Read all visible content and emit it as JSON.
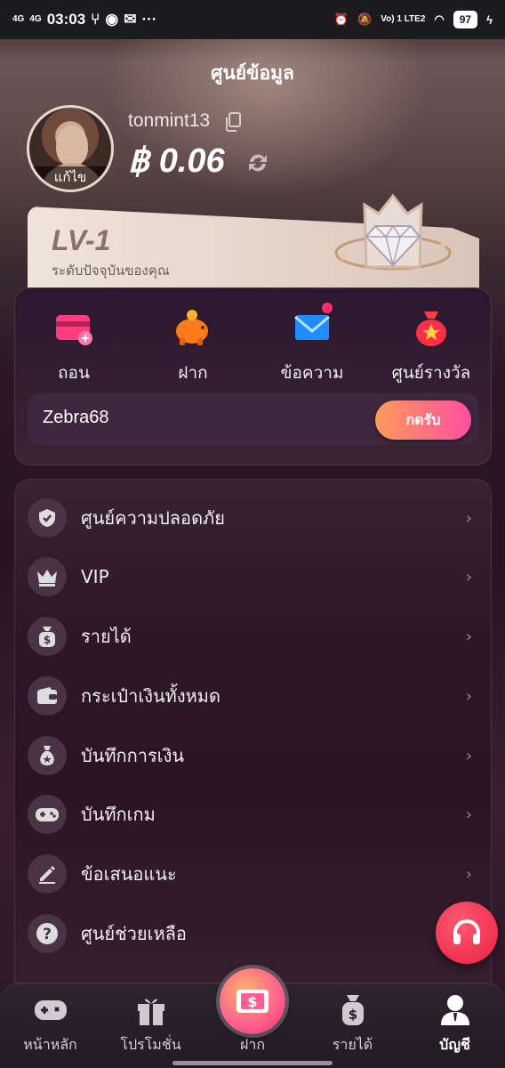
{
  "status_bar": {
    "signal_1": "4G",
    "signal_2": "4G",
    "time": "03:03",
    "network": "Vo) 1 LTE2",
    "battery": "97"
  },
  "header": {
    "title": "ศูนย์ข้อมูล",
    "avatar_edit": "แก้ไข",
    "username": "tonmint13",
    "balance": "฿ 0.06"
  },
  "level": {
    "name": "LV-1",
    "subtitle": "ระดับปัจจุบันของคุณ"
  },
  "quick_actions": [
    {
      "label": "ถอน",
      "icon": "withdraw-card-icon"
    },
    {
      "label": "ฝาก",
      "icon": "piggy-bank-icon"
    },
    {
      "label": "ข้อความ",
      "icon": "mail-icon"
    },
    {
      "label": "ศูนย์รางวัล",
      "icon": "reward-bag-icon"
    }
  ],
  "promo": {
    "name": "Zebra68",
    "claim_label": "กดรับ"
  },
  "menu": [
    {
      "label": "ศูนย์ความปลอดภัย",
      "icon": "shield-check-icon"
    },
    {
      "label": "VIP",
      "icon": "crown-icon"
    },
    {
      "label": "รายได้",
      "icon": "money-bag-icon"
    },
    {
      "label": "กระเป๋าเงินทั้งหมด",
      "icon": "wallet-icon"
    },
    {
      "label": "บันทึกการเงิน",
      "icon": "money-sack-icon"
    },
    {
      "label": "บันทึกเกม",
      "icon": "gamepad-icon"
    },
    {
      "label": "ข้อเสนอแนะ",
      "icon": "pencil-icon"
    },
    {
      "label": "ศูนย์ช่วยเหลือ",
      "icon": "question-icon"
    }
  ],
  "bottom_nav": [
    {
      "label": "หน้าหลัก",
      "icon": "gamepad-icon"
    },
    {
      "label": "โปรโมชั่น",
      "icon": "gift-icon"
    },
    {
      "label": "ฝาก",
      "icon": "deposit-icon"
    },
    {
      "label": "รายได้",
      "icon": "money-bag-icon"
    },
    {
      "label": "บัญชี",
      "icon": "account-icon"
    }
  ],
  "colors": {
    "accent_pink": "#ff4fa0",
    "accent_orange": "#ff9a5a",
    "support_red": "#e8203f"
  }
}
